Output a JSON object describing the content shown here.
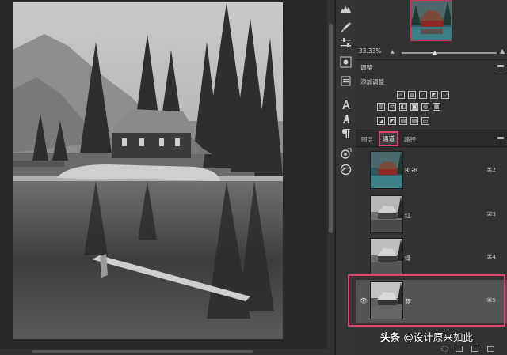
{
  "navigator": {
    "zoom": "33.33%"
  },
  "adjustments": {
    "tab_label": "调整",
    "subtitle": "添加调整"
  },
  "channels_panel": {
    "tabs": [
      {
        "label": "图层"
      },
      {
        "label": "通道"
      },
      {
        "label": "路径"
      }
    ],
    "channels": [
      {
        "name": "RGB",
        "shortcut": "⌘2"
      },
      {
        "name": "红",
        "shortcut": "⌘3"
      },
      {
        "name": "绿",
        "shortcut": "⌘4"
      },
      {
        "name": "蓝",
        "shortcut": "⌘5"
      }
    ]
  },
  "watermark": {
    "brand": "头条",
    "handle": "@设计原来如此"
  },
  "colors": {
    "highlight": "#e2446d",
    "panel_bg": "#323232",
    "selected_row": "#545454"
  }
}
